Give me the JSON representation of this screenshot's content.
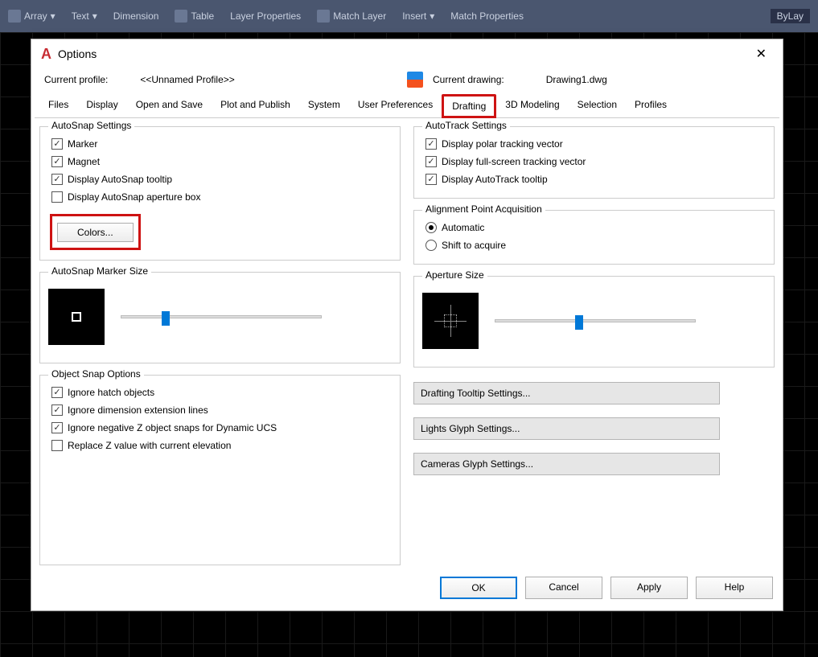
{
  "ribbon": {
    "array": "Array",
    "text": "Text",
    "dimension": "Dimension",
    "table": "Table",
    "layer_props": "Layer Properties",
    "match_layer": "Match Layer",
    "insert": "Insert",
    "match_props": "Match Properties",
    "bylayer": "ByLay"
  },
  "dialog": {
    "title": "Options",
    "profile_label": "Current profile:",
    "profile_value": "<<Unnamed Profile>>",
    "drawing_label": "Current drawing:",
    "drawing_value": "Drawing1.dwg",
    "tabs": [
      "Files",
      "Display",
      "Open and Save",
      "Plot and Publish",
      "System",
      "User Preferences",
      "Drafting",
      "3D Modeling",
      "Selection",
      "Profiles"
    ],
    "active_tab": "Drafting",
    "groups": {
      "autosnap": {
        "title": "AutoSnap Settings",
        "marker": "Marker",
        "magnet": "Magnet",
        "tooltip": "Display AutoSnap tooltip",
        "aperture": "Display AutoSnap aperture box",
        "colors_btn": "Colors..."
      },
      "autotrack": {
        "title": "AutoTrack Settings",
        "polar": "Display polar tracking vector",
        "fullscreen": "Display full-screen tracking vector",
        "tooltip": "Display AutoTrack tooltip"
      },
      "alignment": {
        "title": "Alignment Point Acquisition",
        "auto": "Automatic",
        "shift": "Shift to acquire"
      },
      "marker_size": {
        "title": "AutoSnap Marker Size"
      },
      "aperture_size": {
        "title": "Aperture Size"
      },
      "osnap": {
        "title": "Object Snap Options",
        "hatch": "Ignore hatch objects",
        "dim": "Ignore dimension extension lines",
        "negz": "Ignore negative Z object snaps for Dynamic UCS",
        "replacez": "Replace Z value with current elevation"
      }
    },
    "wide_buttons": {
      "tooltip": "Drafting Tooltip Settings...",
      "lights": "Lights Glyph Settings...",
      "cameras": "Cameras Glyph Settings..."
    },
    "buttons": {
      "ok": "OK",
      "cancel": "Cancel",
      "apply": "Apply",
      "help": "Help"
    }
  }
}
